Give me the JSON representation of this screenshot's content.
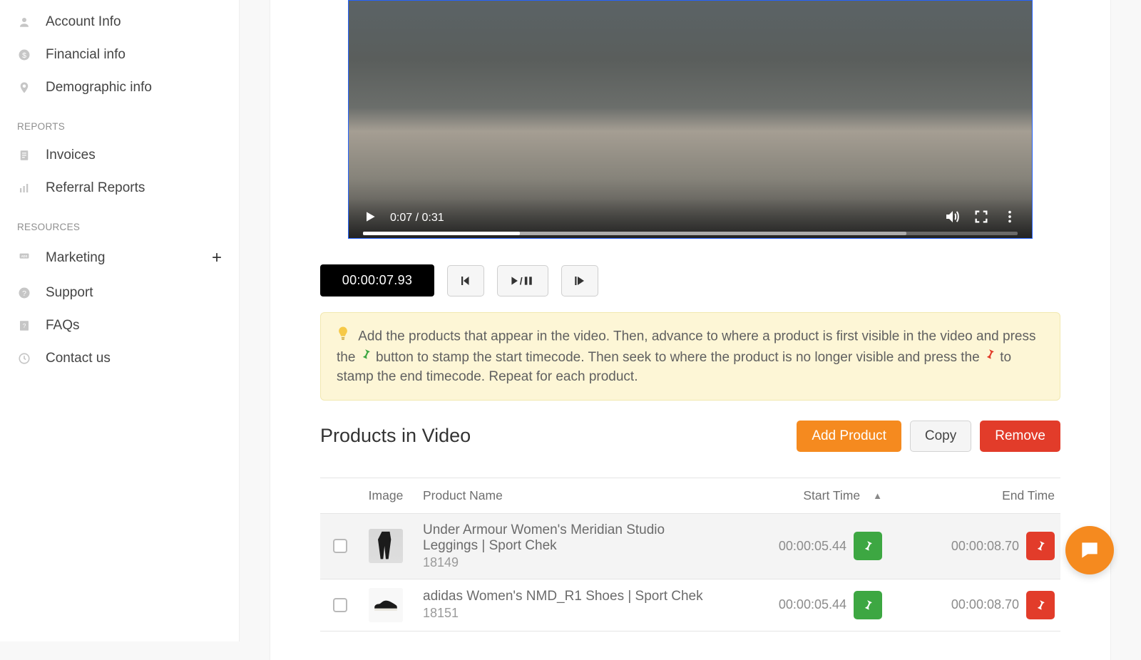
{
  "sidebar": {
    "items_top": [
      {
        "label": "Account Info",
        "icon": "user"
      },
      {
        "label": "Financial info",
        "icon": "dollar"
      },
      {
        "label": "Demographic info",
        "icon": "pin"
      }
    ],
    "section_reports": "REPORTS",
    "items_reports": [
      {
        "label": "Invoices",
        "icon": "doc"
      },
      {
        "label": "Referral Reports",
        "icon": "bars"
      }
    ],
    "section_resources": "RESOURCES",
    "items_resources": [
      {
        "label": "Marketing",
        "icon": "ads",
        "expandable": true
      },
      {
        "label": "Support",
        "icon": "help"
      },
      {
        "label": "FAQs",
        "icon": "faq"
      },
      {
        "label": "Contact us",
        "icon": "clock"
      }
    ]
  },
  "video": {
    "elapsed": "0:07",
    "duration": "0:31",
    "progress_pct": 24,
    "buffer_pct": 83
  },
  "timecode": "00:00:07.93",
  "tip_text_1": "Add the products that appear in the video. Then, advance to where a product is first visible in the video and press the",
  "tip_text_2": "button to stamp the start timecode. Then seek to where the product is no longer visible and press the",
  "tip_text_3": "to stamp the end timecode. Repeat for each product.",
  "products_section": {
    "title": "Products in Video",
    "add_label": "Add Product",
    "copy_label": "Copy",
    "remove_label": "Remove"
  },
  "table": {
    "headers": {
      "image": "Image",
      "name": "Product Name",
      "start": "Start Time",
      "end": "End Time"
    },
    "rows": [
      {
        "name": "Under Armour Women's Meridian Studio Leggings | Sport Chek",
        "sku": "18149",
        "start": "00:00:05.44",
        "end": "00:00:08.70",
        "thumb": "pants"
      },
      {
        "name": "adidas Women's NMD_R1 Shoes | Sport Chek",
        "sku": "18151",
        "start": "00:00:05.44",
        "end": "00:00:08.70",
        "thumb": "shoe"
      }
    ]
  },
  "colors": {
    "accent_orange": "#f58a1f",
    "danger_red": "#e23c2a",
    "ok_green": "#3da742"
  }
}
